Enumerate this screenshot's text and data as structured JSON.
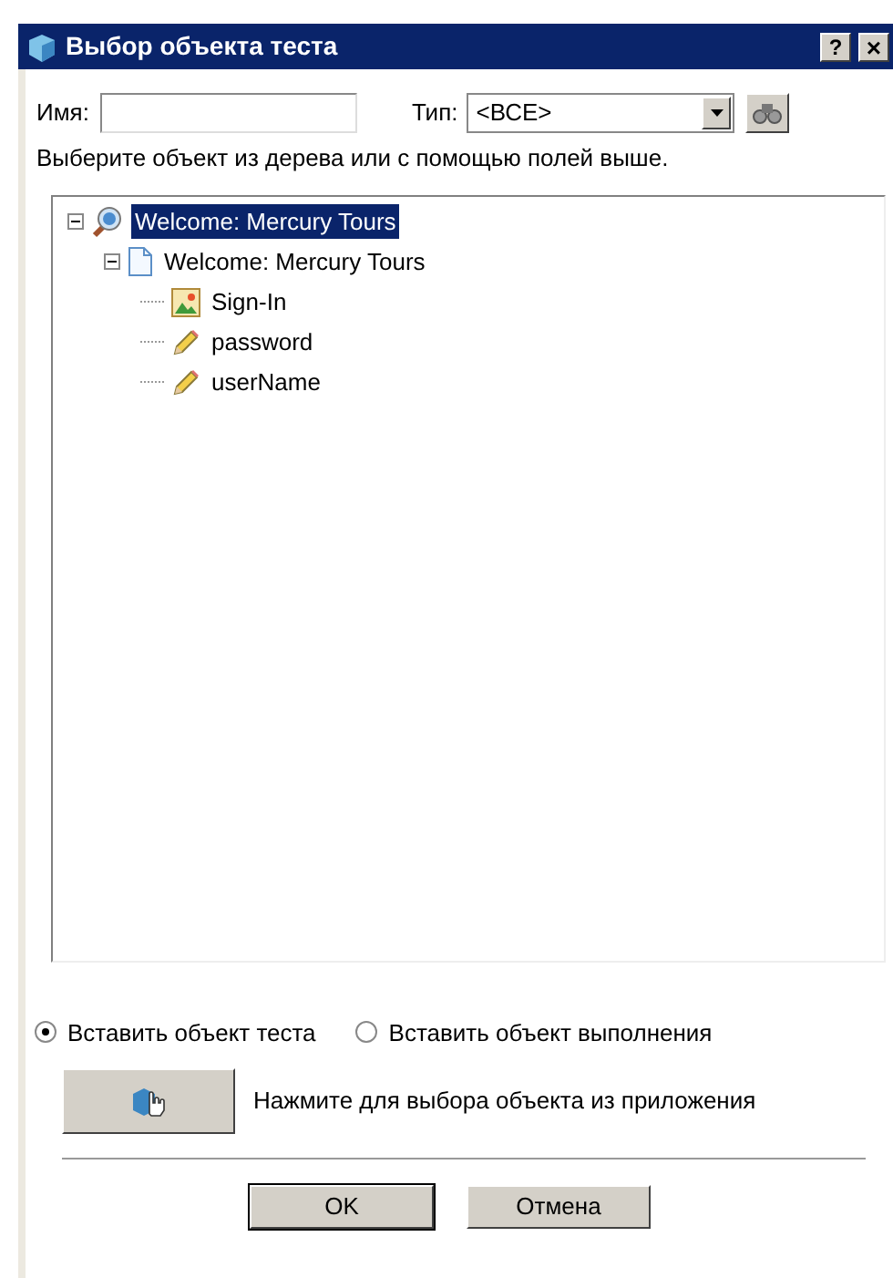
{
  "window": {
    "title": "Выбор объекта теста",
    "help": "?",
    "close": "×"
  },
  "filters": {
    "name_label": "Имя:",
    "type_label": "Тип:",
    "type_value": "<ВСЕ>"
  },
  "hint": "Выберите объект из дерева или с помощью полей выше.",
  "tree": [
    {
      "label": "Welcome: Mercury Tours",
      "kind": "browser",
      "expanded": true,
      "selected": true,
      "children": [
        {
          "label": "Welcome: Mercury Tours",
          "kind": "page",
          "expanded": true,
          "selected": false,
          "children": [
            {
              "label": "Sign-In",
              "kind": "image",
              "selected": false
            },
            {
              "label": "password",
              "kind": "edit",
              "selected": false
            },
            {
              "label": "userName",
              "kind": "edit",
              "selected": false
            }
          ]
        }
      ]
    }
  ],
  "options": [
    {
      "label": "Вставить объект теста",
      "selected": true
    },
    {
      "label": "Вставить объект выполнения",
      "selected": false
    }
  ],
  "pick_hint": "Нажмите для выбора объекта из приложения",
  "buttons": [
    {
      "label": "OK",
      "default": true
    },
    {
      "label": "Отмена",
      "default": false
    }
  ]
}
